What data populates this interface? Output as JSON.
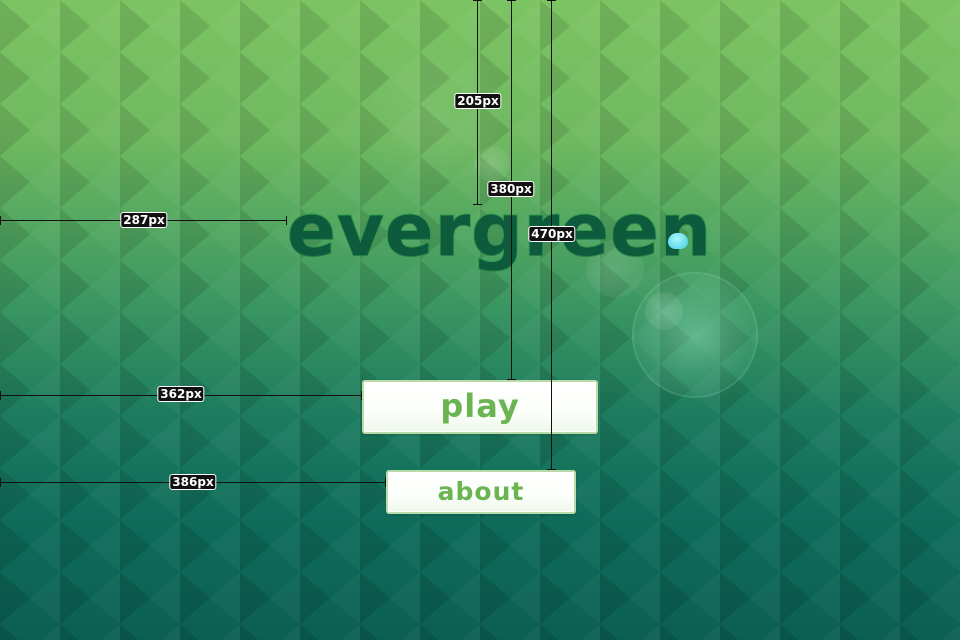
{
  "game": {
    "title": "evergreen",
    "menu": {
      "play_label": "play",
      "about_label": "about"
    }
  },
  "colors": {
    "background_top": "#7cc463",
    "background_bottom": "#0b5f52",
    "logo_fill": "#0d5a3c",
    "logo_outline": "#2f9a4e",
    "logo_dot": "#6ee2ee",
    "button_face": "#ffffff",
    "button_text": "#6ab552",
    "button_border": "#b9dba9"
  },
  "measurements": {
    "logo_top_gap": "205px",
    "play_top_gap": "380px",
    "about_top_gap": "470px",
    "logo_left_gap": "287px",
    "play_left_gap": "362px",
    "about_left_gap": "386px"
  }
}
